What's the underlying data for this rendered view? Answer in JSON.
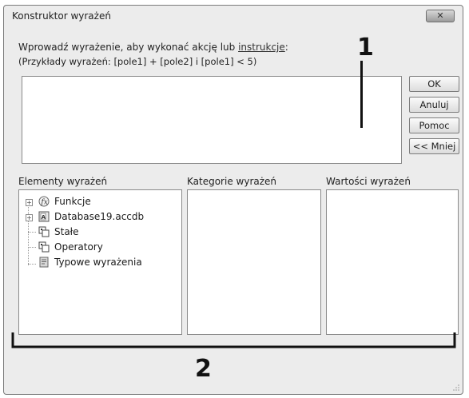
{
  "window": {
    "title": "Konstruktor wyrażeń",
    "close_label": "✕"
  },
  "prompt": {
    "line1_prefix": "Wprowadź wyrażenie, aby wykonać akcję lub ",
    "line1_link": "instrukcje",
    "line1_suffix": ":",
    "line2": "(Przykłady wyrażeń: [pole1] + [pole2] i [pole1] < 5)"
  },
  "expression": {
    "value": ""
  },
  "buttons": {
    "ok": "OK",
    "cancel": "Anuluj",
    "help": "Pomoc",
    "less": "<< Mniej"
  },
  "panels": {
    "elements_label": "Elementy wyrażeń",
    "categories_label": "Kategorie wyrażeń",
    "values_label": "Wartości wyrażeń"
  },
  "tree": {
    "items": [
      {
        "label": "Funkcje",
        "icon": "function-icon",
        "expandable": true
      },
      {
        "label": "Database19.accdb",
        "icon": "database-icon",
        "expandable": true
      },
      {
        "label": "Stałe",
        "icon": "constants-icon",
        "expandable": false
      },
      {
        "label": "Operatory",
        "icon": "operators-icon",
        "expandable": false
      },
      {
        "label": "Typowe wyrażenia",
        "icon": "common-expressions-icon",
        "expandable": false
      }
    ]
  },
  "callouts": {
    "one": "1",
    "two": "2"
  }
}
